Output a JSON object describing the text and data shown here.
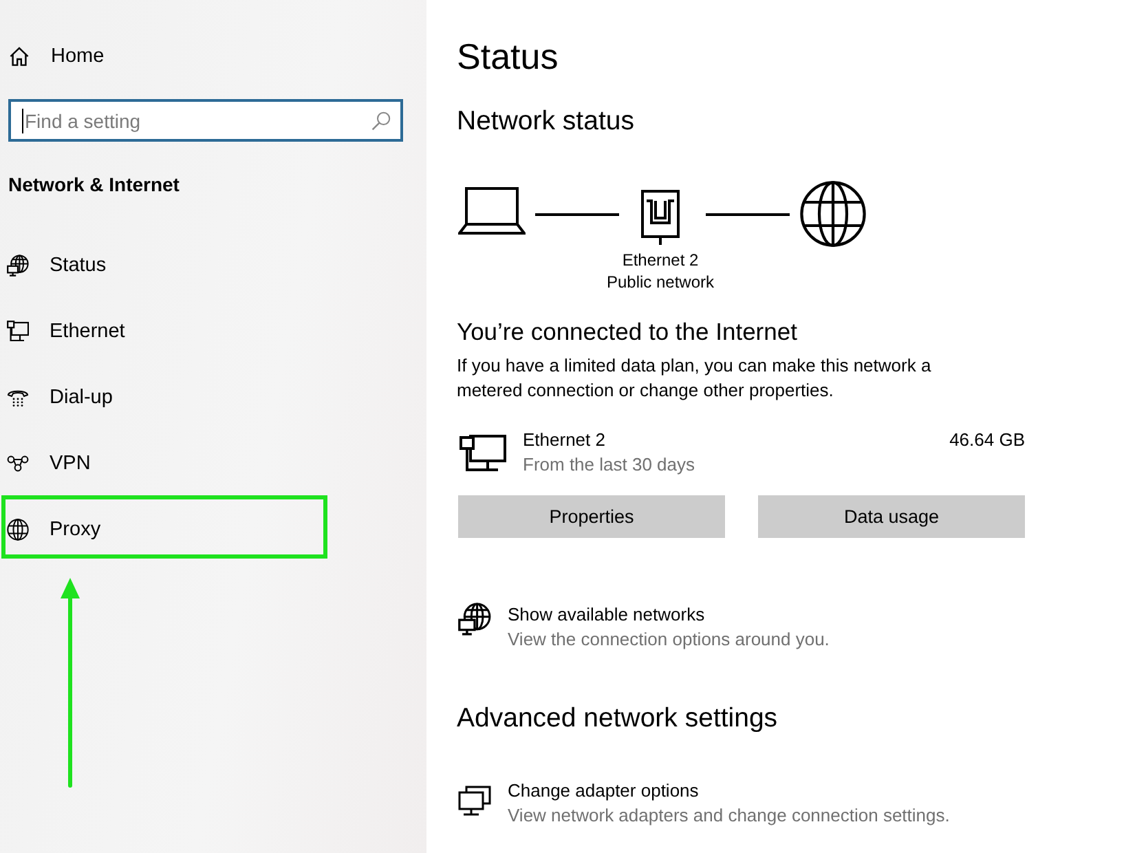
{
  "sidebar": {
    "home": {
      "label": "Home"
    },
    "search": {
      "placeholder": "Find a setting",
      "focused": true
    },
    "section_title": "Network & Internet",
    "items": [
      {
        "label": "Status",
        "highlighted": false
      },
      {
        "label": "Ethernet",
        "highlighted": false
      },
      {
        "label": "Dial-up",
        "highlighted": false
      },
      {
        "label": "VPN",
        "highlighted": false
      },
      {
        "label": "Proxy",
        "highlighted": true
      }
    ]
  },
  "main": {
    "title": "Status",
    "network_status": {
      "heading": "Network status",
      "adapter": "Ethernet 2",
      "network_type": "Public network"
    },
    "connection": {
      "heading": "You’re connected to the Internet",
      "description": "If you have a limited data plan, you can make this network a metered connection or change other properties.",
      "usage": {
        "name": "Ethernet 2",
        "period": "From the last 30 days",
        "amount": "46.64 GB"
      },
      "buttons": [
        {
          "label": "Properties"
        },
        {
          "label": "Data usage"
        }
      ]
    },
    "network_links": [
      {
        "title": "Show available networks",
        "description": "View the connection options around you."
      }
    ],
    "advanced": {
      "heading": "Advanced network settings",
      "links": [
        {
          "title": "Change adapter options",
          "description": "View network adapters and change connection settings."
        }
      ]
    }
  }
}
